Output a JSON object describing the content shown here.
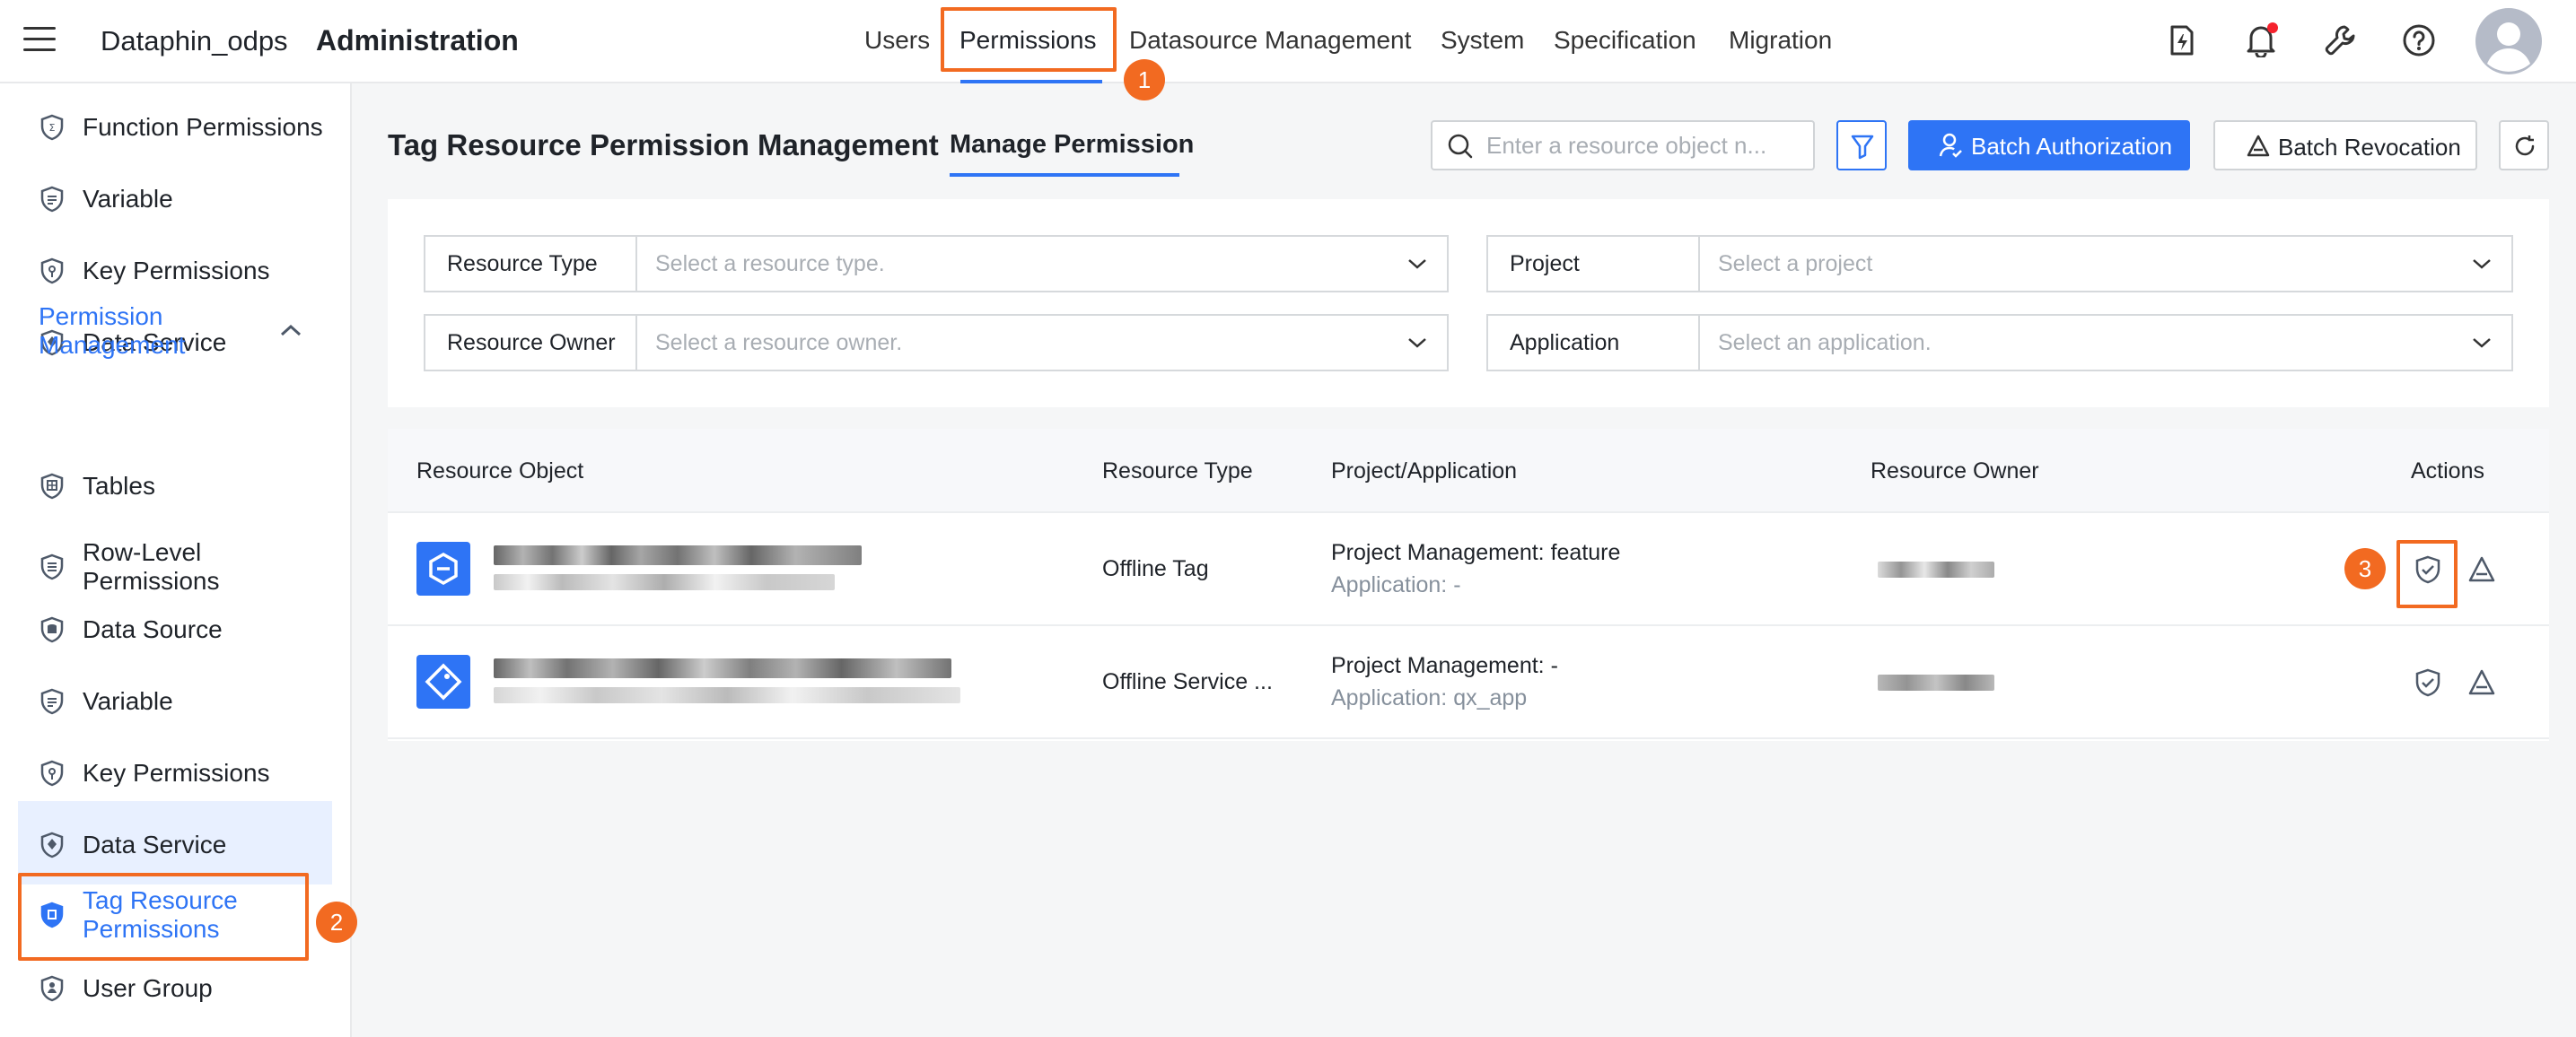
{
  "header": {
    "brand": "Dataphin_odps",
    "title": "Administration",
    "nav": [
      {
        "label": "Users"
      },
      {
        "label": "Permissions"
      },
      {
        "label": "Datasource Management"
      },
      {
        "label": "System"
      },
      {
        "label": "Specification"
      },
      {
        "label": "Migration"
      }
    ],
    "active_nav": "Permissions"
  },
  "sidebar": {
    "items_top": [
      {
        "label": "Function Permissions"
      },
      {
        "label": "Variable"
      },
      {
        "label": "Key Permissions"
      },
      {
        "label": "Data Service"
      }
    ],
    "group": {
      "label": "Permission Management"
    },
    "items_group": [
      {
        "label": "Tables"
      },
      {
        "label": "Row-Level Permissions"
      },
      {
        "label": "Data Source"
      },
      {
        "label": "Variable"
      },
      {
        "label": "Key Permissions"
      },
      {
        "label": "Data Service"
      },
      {
        "label": "Tag Resource Permissions"
      },
      {
        "label": "User Group"
      }
    ],
    "active_item": "Tag Resource Permissions"
  },
  "page": {
    "title": "Tag Resource Permission Management",
    "tab": "Manage Permission",
    "search_placeholder": "Enter a resource object n...",
    "batch_authorization": "Batch Authorization",
    "batch_revocation": "Batch Revocation"
  },
  "filters": {
    "resource_type": {
      "label": "Resource Type",
      "placeholder": "Select a resource type."
    },
    "project": {
      "label": "Project",
      "placeholder": "Select a project"
    },
    "resource_owner": {
      "label": "Resource Owner",
      "placeholder": "Select a resource owner."
    },
    "application": {
      "label": "Application",
      "placeholder": "Select an application."
    }
  },
  "table": {
    "columns": [
      "Resource Object",
      "Resource Type",
      "Project/Application",
      "Resource Owner",
      "Actions"
    ],
    "rows": [
      {
        "resource_type": "Offline Tag",
        "project": "Project Management: feature",
        "application": "Application: -"
      },
      {
        "resource_type": "Offline Service ...",
        "project": "Project Management: -",
        "application": "Application: qx_app"
      }
    ]
  },
  "annotations": [
    "1",
    "2",
    "3"
  ],
  "colors": {
    "accent": "#2e74f5",
    "highlight": "#f26a21",
    "notification_dot": "#f5222d"
  }
}
